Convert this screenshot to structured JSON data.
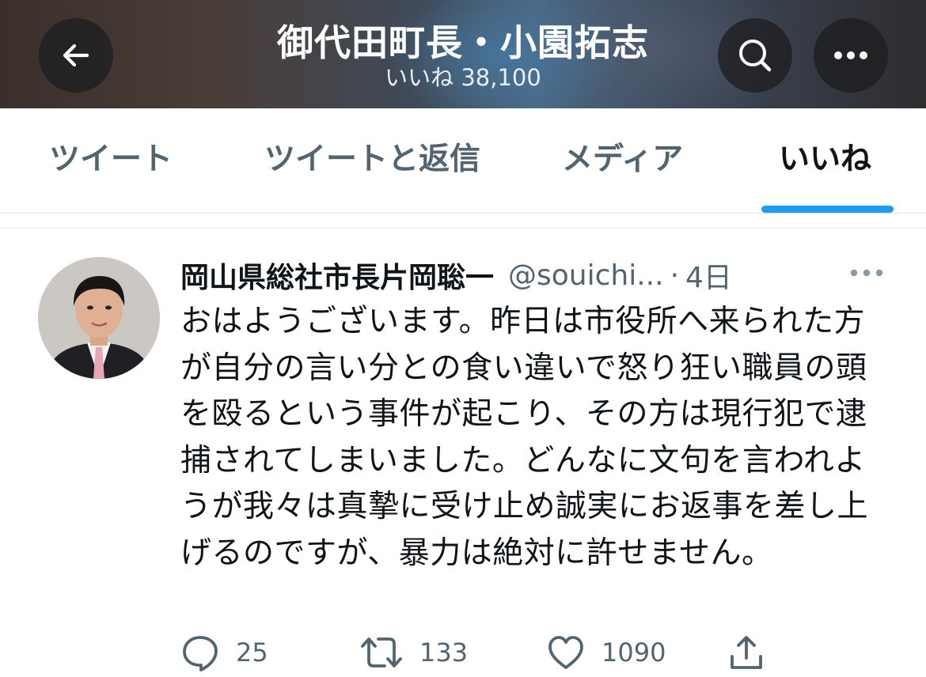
{
  "header": {
    "title": "御代田町長・小園拓志",
    "subtitle": "いいね 38,100",
    "back_icon": "arrow-left-icon",
    "search_icon": "search-icon",
    "more_icon": "more-horizontal-icon"
  },
  "tabs": [
    {
      "label": "ツイート",
      "active": false
    },
    {
      "label": "ツイートと返信",
      "active": false
    },
    {
      "label": "メディア",
      "active": false
    },
    {
      "label": "いいね",
      "active": true
    }
  ],
  "colors": {
    "accent": "#1d9bf0",
    "text_primary": "#0f1419",
    "text_secondary": "#536471"
  },
  "tweet": {
    "author_name": "岡山県総社市長片岡聡一",
    "author_handle": "@souichi...",
    "separator": "·",
    "time": "4日",
    "text": "おはようございます。昨日は市役所へ来られた方が自分の言い分との食い違いで怒り狂い職員の頭を殴るという事件が起こり、その方は現行犯で逮捕されてしまいました。どんなに文句を言われようが我々は真摯に受け止め誠実にお返事を差し上げるのですが、暴力は絶対に許せません。",
    "actions": {
      "reply_count": "25",
      "retweet_count": "133",
      "like_count": "1090"
    }
  }
}
